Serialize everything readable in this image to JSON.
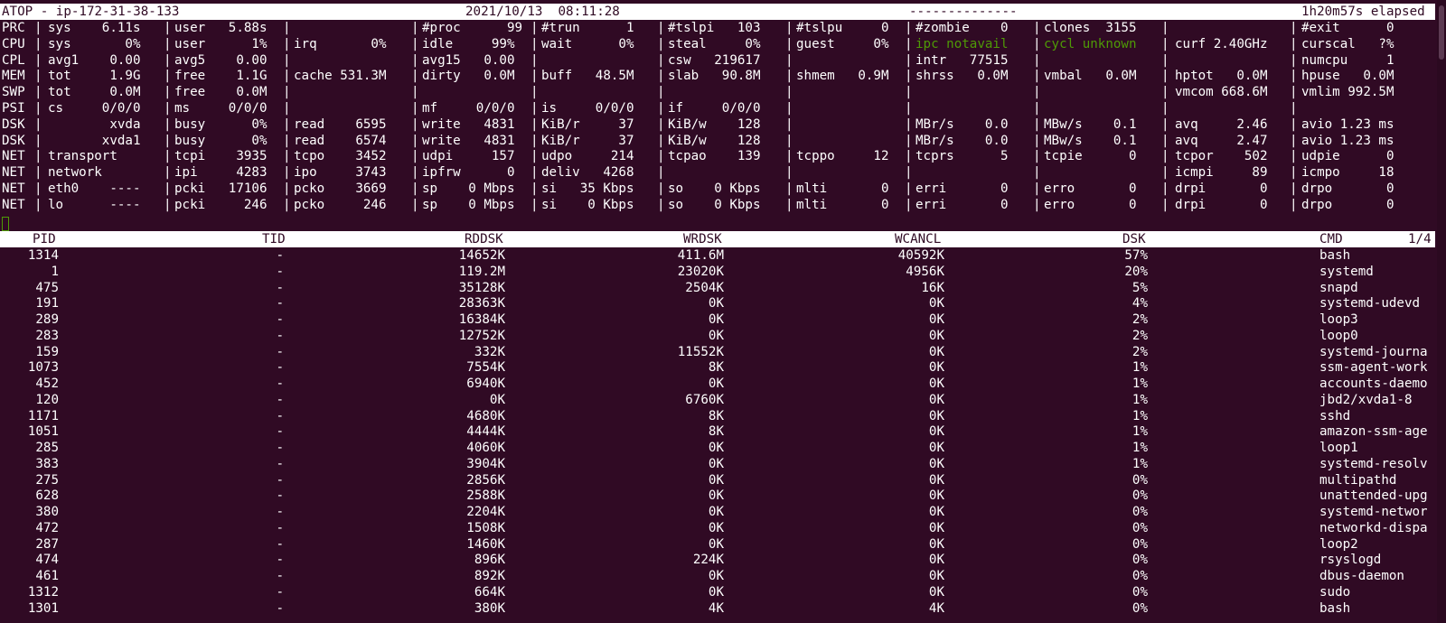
{
  "header": {
    "title": "ATOP - ip-172-31-38-133",
    "datetime": "2021/10/13  08:11:28",
    "dashes": "--------------",
    "elapsed": "1h20m57s elapsed"
  },
  "colors": {
    "background": "#300a24",
    "text": "#ffffff",
    "notavail": "#4e9a06"
  },
  "system_rows": [
    {
      "label": "PRC",
      "cells": [
        "sys    6.11s",
        "user   5.88s",
        "",
        "#proc      99",
        "#trun      1",
        "#tslpi   103",
        "#tslpu     0",
        "#zombie    0",
        "clones  3155",
        "",
        "#exit      0"
      ]
    },
    {
      "label": "CPU",
      "cells": [
        "sys       0%",
        "user      1%",
        "irq       0%",
        "idle     99%",
        "wait      0%",
        "steal     0%",
        "guest     0%",
        "ipc notavail",
        "cycl unknown",
        "curf 2.40GHz",
        "curscal   ?%"
      ]
    },
    {
      "label": "CPL",
      "cells": [
        "avg1    0.00",
        "avg5    0.00",
        "",
        "avg15   0.00",
        "",
        "csw   219617",
        "",
        "intr   77515",
        "",
        "",
        "numcpu     1"
      ]
    },
    {
      "label": "MEM",
      "cells": [
        "tot     1.9G",
        "free    1.1G",
        "cache 531.3M",
        "dirty   0.0M",
        "buff   48.5M",
        "slab   90.8M",
        "shmem   0.9M",
        "shrss   0.0M",
        "vmbal   0.0M",
        "hptot   0.0M",
        "hpuse   0.0M"
      ]
    },
    {
      "label": "SWP",
      "cells": [
        "tot     0.0M",
        "free    0.0M",
        "",
        "",
        "",
        "",
        "",
        "",
        "",
        "vmcom 668.6M",
        "vmlim 992.5M"
      ]
    },
    {
      "label": "PSI",
      "cells": [
        "cs     0/0/0",
        "ms     0/0/0",
        "",
        "mf     0/0/0",
        "is     0/0/0",
        "if     0/0/0",
        "",
        "",
        "",
        "",
        ""
      ]
    },
    {
      "label": "DSK",
      "cells": [
        "        xvda",
        "busy      0%",
        "read    6595",
        "write   4831",
        "KiB/r     37",
        "KiB/w    128",
        "",
        "MBr/s    0.0",
        "MBw/s    0.1",
        "avq     2.46",
        "avio 1.23 ms"
      ]
    },
    {
      "label": "DSK",
      "cells": [
        "       xvda1",
        "busy      0%",
        "read    6574",
        "write   4831",
        "KiB/r     37",
        "KiB/w    128",
        "",
        "MBr/s    0.0",
        "MBw/s    0.1",
        "avq     2.47",
        "avio 1.23 ms"
      ]
    },
    {
      "label": "NET",
      "cells": [
        "transport",
        "tcpi    3935",
        "tcpo    3452",
        "udpi     157",
        "udpo     214",
        "tcpao    139",
        "tcppo     12",
        "tcprs      5",
        "tcpie      0",
        "tcpor    502",
        "udpie      0"
      ]
    },
    {
      "label": "NET",
      "cells": [
        "network",
        "ipi     4283",
        "ipo     3743",
        "ipfrw      0",
        "deliv   4268",
        "",
        "",
        "",
        "",
        "icmpi     89",
        "icmpo     18"
      ]
    },
    {
      "label": "NET",
      "cells": [
        "eth0    ----",
        "pcki   17106",
        "pcko    3669",
        "sp    0 Mbps",
        "si   35 Kbps",
        "so    0 Kbps",
        "mlti       0",
        "erri       0",
        "erro       0",
        "drpi       0",
        "drpo       0"
      ]
    },
    {
      "label": "NET",
      "cells": [
        "lo      ----",
        "pcki     246",
        "pcko     246",
        "sp    0 Mbps",
        "si    0 Kbps",
        "so    0 Kbps",
        "mlti       0",
        "erri       0",
        "erro       0",
        "drpi       0",
        "drpo       0"
      ]
    }
  ],
  "process_table": {
    "columns": [
      "PID",
      "TID",
      "RDDSK",
      "WRDSK",
      "WCANCL",
      "DSK",
      "CMD"
    ],
    "page": "1/4",
    "rows": [
      [
        "1314",
        "-",
        "14652K",
        "411.6M",
        "40592K",
        "57%",
        "bash"
      ],
      [
        "1",
        "-",
        "119.2M",
        "23020K",
        "4956K",
        "20%",
        "systemd"
      ],
      [
        "475",
        "-",
        "35128K",
        "2504K",
        "16K",
        "5%",
        "snapd"
      ],
      [
        "191",
        "-",
        "28363K",
        "0K",
        "0K",
        "4%",
        "systemd-udevd"
      ],
      [
        "289",
        "-",
        "16384K",
        "0K",
        "0K",
        "2%",
        "loop3"
      ],
      [
        "283",
        "-",
        "12752K",
        "0K",
        "0K",
        "2%",
        "loop0"
      ],
      [
        "159",
        "-",
        "332K",
        "11552K",
        "0K",
        "2%",
        "systemd-journa"
      ],
      [
        "1073",
        "-",
        "7554K",
        "8K",
        "0K",
        "1%",
        "ssm-agent-work"
      ],
      [
        "452",
        "-",
        "6940K",
        "0K",
        "0K",
        "1%",
        "accounts-daemo"
      ],
      [
        "120",
        "-",
        "0K",
        "6760K",
        "0K",
        "1%",
        "jbd2/xvda1-8"
      ],
      [
        "1171",
        "-",
        "4680K",
        "8K",
        "0K",
        "1%",
        "sshd"
      ],
      [
        "1051",
        "-",
        "4444K",
        "8K",
        "0K",
        "1%",
        "amazon-ssm-age"
      ],
      [
        "285",
        "-",
        "4060K",
        "0K",
        "0K",
        "1%",
        "loop1"
      ],
      [
        "383",
        "-",
        "3904K",
        "0K",
        "0K",
        "1%",
        "systemd-resolv"
      ],
      [
        "275",
        "-",
        "2856K",
        "0K",
        "0K",
        "0%",
        "multipathd"
      ],
      [
        "628",
        "-",
        "2588K",
        "0K",
        "0K",
        "0%",
        "unattended-upg"
      ],
      [
        "380",
        "-",
        "2204K",
        "0K",
        "0K",
        "0%",
        "systemd-networ"
      ],
      [
        "472",
        "-",
        "1508K",
        "0K",
        "0K",
        "0%",
        "networkd-dispa"
      ],
      [
        "287",
        "-",
        "1460K",
        "0K",
        "0K",
        "0%",
        "loop2"
      ],
      [
        "474",
        "-",
        "896K",
        "224K",
        "0K",
        "0%",
        "rsyslogd"
      ],
      [
        "461",
        "-",
        "892K",
        "0K",
        "0K",
        "0%",
        "dbus-daemon"
      ],
      [
        "1312",
        "-",
        "664K",
        "0K",
        "0K",
        "0%",
        "sudo"
      ],
      [
        "1301",
        "-",
        "380K",
        "4K",
        "4K",
        "0%",
        "bash"
      ]
    ]
  }
}
